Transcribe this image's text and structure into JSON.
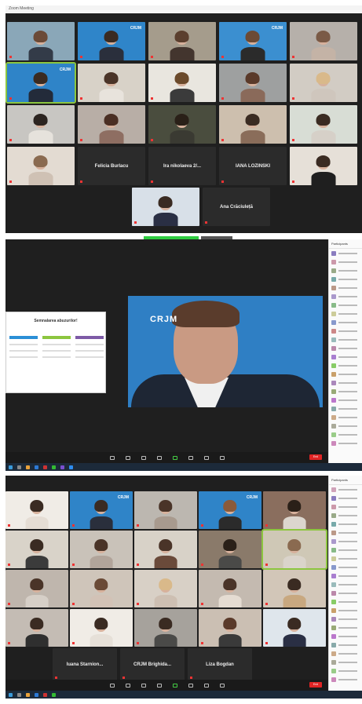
{
  "screen1": {
    "title": "Zoom Meeting",
    "grid": [
      {
        "name": "",
        "kind": "video",
        "bg": "#8aa7b8",
        "hair": "#6b4a37",
        "body": "#333b48",
        "logo": ""
      },
      {
        "name": "",
        "kind": "video",
        "bg": "#2f85c9",
        "hair": "#3a2b22",
        "body": "#2a2f3c",
        "logo": "CRJM"
      },
      {
        "name": "",
        "kind": "video",
        "bg": "#a59c8c",
        "hair": "#5b3f2e",
        "body": "#43352e",
        "logo": ""
      },
      {
        "name": "",
        "kind": "video",
        "bg": "#3b8fd0",
        "hair": "#6c4a34",
        "body": "#2b2b2b",
        "logo": "CRJM"
      },
      {
        "name": "",
        "kind": "video",
        "bg": "#b6b0aa",
        "hair": "#7a5a46",
        "body": "#c4b3a6",
        "logo": ""
      },
      {
        "name": "",
        "kind": "video",
        "bg": "#2f84c8",
        "hair": "#3a2b22",
        "body": "#232b3a",
        "logo": "CRJM",
        "active": true
      },
      {
        "name": "",
        "kind": "video",
        "bg": "#d8d2c8",
        "hair": "#4a3428",
        "body": "#e8e3dc",
        "logo": ""
      },
      {
        "name": "",
        "kind": "video",
        "bg": "#e9e6df",
        "hair": "#6b4a2b",
        "body": "#3b3b3b",
        "logo": ""
      },
      {
        "name": "",
        "kind": "video",
        "bg": "#9ea0a0",
        "hair": "#5a3a2a",
        "body": "#8a6a5a",
        "logo": ""
      },
      {
        "name": "",
        "kind": "video",
        "bg": "#d2ccc4",
        "hair": "#d9b98a",
        "body": "#cfc6bd",
        "logo": ""
      },
      {
        "name": "",
        "kind": "video",
        "bg": "#c8c6c2",
        "hair": "#2c2420",
        "body": "#e6e2dc",
        "logo": ""
      },
      {
        "name": "",
        "kind": "video",
        "bg": "#b8aea6",
        "hair": "#4a2f24",
        "body": "#8e6e62",
        "logo": ""
      },
      {
        "name": "",
        "kind": "video",
        "bg": "#4a4d3e",
        "hair": "#2a2018",
        "body": "#3a3a32",
        "logo": ""
      },
      {
        "name": "",
        "kind": "video",
        "bg": "#cdbfae",
        "hair": "#3a2b22",
        "body": "#8a6d5a",
        "logo": ""
      },
      {
        "name": "",
        "kind": "video",
        "bg": "#d8ddd5",
        "hair": "#3a2b22",
        "body": "#d6d0c8",
        "logo": ""
      },
      {
        "name": "",
        "kind": "video",
        "bg": "#e3dbd2",
        "hair": "#8a6a50",
        "body": "#cfc1b4",
        "logo": ""
      },
      {
        "name": "Felicia Burlacu",
        "kind": "name"
      },
      {
        "name": "Ira nikolaeva 2/...",
        "kind": "name"
      },
      {
        "name": "IANA LOZINSKI",
        "kind": "name"
      },
      {
        "name": "",
        "kind": "video",
        "bg": "#e6e0d8",
        "hair": "#3a2b22",
        "body": "#1f1f1f",
        "logo": ""
      }
    ],
    "lastrow": [
      {
        "name": "",
        "kind": "video",
        "bg": "#d8e0e8",
        "hair": "#3a2b22",
        "body": "#2a2f44",
        "logo": ""
      },
      {
        "name": "Ana Crăciuleță",
        "kind": "name"
      }
    ]
  },
  "screen2": {
    "slide_title": "Semnalarea abuzurilor!",
    "slide_colors": [
      "#2b8fd6",
      "#8cc63f",
      "#7d5aa6"
    ],
    "speaker_logo": "CRJM",
    "panel_title": "Participants",
    "participants": [
      {
        "color": "#8a7cbf"
      },
      {
        "color": "#c9a"
      },
      {
        "color": "#9a8"
      },
      {
        "color": "#7aa"
      },
      {
        "color": "#b98"
      },
      {
        "color": "#a9c"
      },
      {
        "color": "#8b8"
      },
      {
        "color": "#cc9"
      },
      {
        "color": "#89c"
      },
      {
        "color": "#c88"
      },
      {
        "color": "#9bb"
      },
      {
        "color": "#b8a"
      },
      {
        "color": "#a97ed0"
      },
      {
        "color": "#8c6"
      },
      {
        "color": "#c9a06a"
      },
      {
        "color": "#a8b"
      },
      {
        "color": "#9a7"
      },
      {
        "color": "#b7c"
      },
      {
        "color": "#8aa"
      },
      {
        "color": "#ca8"
      },
      {
        "color": "#aa9"
      },
      {
        "color": "#9c8"
      },
      {
        "color": "#c8b"
      }
    ],
    "end_label": "End"
  },
  "screen3": {
    "grid": [
      {
        "name": "",
        "kind": "video",
        "bg": "#f0ece6",
        "hair": "#3a2b22",
        "body": "#e5ddd4",
        "logo": ""
      },
      {
        "name": "",
        "kind": "video",
        "bg": "#2f84c8",
        "hair": "#3a2b22",
        "body": "#2a2f3c",
        "logo": "CRJM"
      },
      {
        "name": "",
        "kind": "video",
        "bg": "#bcb7b0",
        "hair": "#4a3428",
        "body": "#a89a8e",
        "logo": ""
      },
      {
        "name": "",
        "kind": "video",
        "bg": "#2f84c8",
        "hair": "#8a5a3a",
        "body": "#2b2b2b",
        "logo": "CRJM"
      },
      {
        "name": "",
        "kind": "video",
        "bg": "#8a6e5e",
        "hair": "#2a2018",
        "body": "#dcd6ce",
        "logo": ""
      },
      {
        "name": "",
        "kind": "video",
        "bg": "#d9d3c9",
        "hair": "#3a2b22",
        "body": "#3b3b3b",
        "logo": ""
      },
      {
        "name": "",
        "kind": "video",
        "bg": "#c9c2b9",
        "hair": "#4a3428",
        "body": "#b1a49a",
        "logo": ""
      },
      {
        "name": "",
        "kind": "video",
        "bg": "#d8d2c8",
        "hair": "#4a3428",
        "body": "#6a4a3a",
        "logo": ""
      },
      {
        "name": "",
        "kind": "video",
        "bg": "#8a7a6a",
        "hair": "#2a2018",
        "body": "#4a4a48",
        "logo": ""
      },
      {
        "name": "",
        "kind": "video",
        "bg": "#cfc8b6",
        "hair": "#8a6a50",
        "body": "#dad4cb",
        "logo": "",
        "active": true
      },
      {
        "name": "",
        "kind": "video",
        "bg": "#bfb6ad",
        "hair": "#4a3428",
        "body": "#d6cfc7",
        "logo": ""
      },
      {
        "name": "",
        "kind": "video",
        "bg": "#cfc5ba",
        "hair": "#6a4a36",
        "body": "#d2c2b6",
        "logo": ""
      },
      {
        "name": "",
        "kind": "video",
        "bg": "#d8d0c6",
        "hair": "#d9b98a",
        "body": "#cdbfb2",
        "logo": ""
      },
      {
        "name": "",
        "kind": "video",
        "bg": "#c4bab0",
        "hair": "#4a3428",
        "body": "#e5dcd2",
        "logo": ""
      },
      {
        "name": "",
        "kind": "video",
        "bg": "#d2c6b8",
        "hair": "#3a2b22",
        "body": "#c8a880",
        "logo": ""
      },
      {
        "name": "",
        "kind": "video",
        "bg": "#c4bcb4",
        "hair": "#3a2b22",
        "body": "#2f2f2f",
        "logo": ""
      },
      {
        "name": "",
        "kind": "video",
        "bg": "#f0ece6",
        "hair": "#3a2b22",
        "body": "#e6e0d8",
        "logo": ""
      },
      {
        "name": "",
        "kind": "video",
        "bg": "#a6a29c",
        "hair": "#3a2b22",
        "body": "#4a4a48",
        "logo": ""
      },
      {
        "name": "",
        "kind": "video",
        "bg": "#cbbfb3",
        "hair": "#5a3a2a",
        "body": "#3a3a3a",
        "logo": ""
      },
      {
        "name": "",
        "kind": "video",
        "bg": "#dfe6ec",
        "hair": "#3a2b22",
        "body": "#2a2f44",
        "logo": ""
      }
    ],
    "lastrow": [
      {
        "name": "Iuana Starnion...",
        "kind": "name"
      },
      {
        "name": "CRJM Brighida...",
        "kind": "name"
      },
      {
        "name": "Liza Bogdan",
        "kind": "name"
      }
    ],
    "panel_title": "Participants",
    "participants": [
      {
        "color": "#b79a"
      },
      {
        "color": "#8a7cbf"
      },
      {
        "color": "#c9a"
      },
      {
        "color": "#9a8"
      },
      {
        "color": "#7aa"
      },
      {
        "color": "#b98"
      },
      {
        "color": "#a9c"
      },
      {
        "color": "#8b8"
      },
      {
        "color": "#cc9"
      },
      {
        "color": "#89c"
      },
      {
        "color": "#a97ed0"
      },
      {
        "color": "#9bb"
      },
      {
        "color": "#b8a"
      },
      {
        "color": "#8c6"
      },
      {
        "color": "#c9a06a"
      },
      {
        "color": "#a8b"
      },
      {
        "color": "#9a7"
      },
      {
        "color": "#b7c"
      },
      {
        "color": "#8aa"
      },
      {
        "color": "#ca8"
      },
      {
        "color": "#aa9"
      },
      {
        "color": "#9c8"
      },
      {
        "color": "#c8b"
      }
    ],
    "end_label": "End"
  }
}
